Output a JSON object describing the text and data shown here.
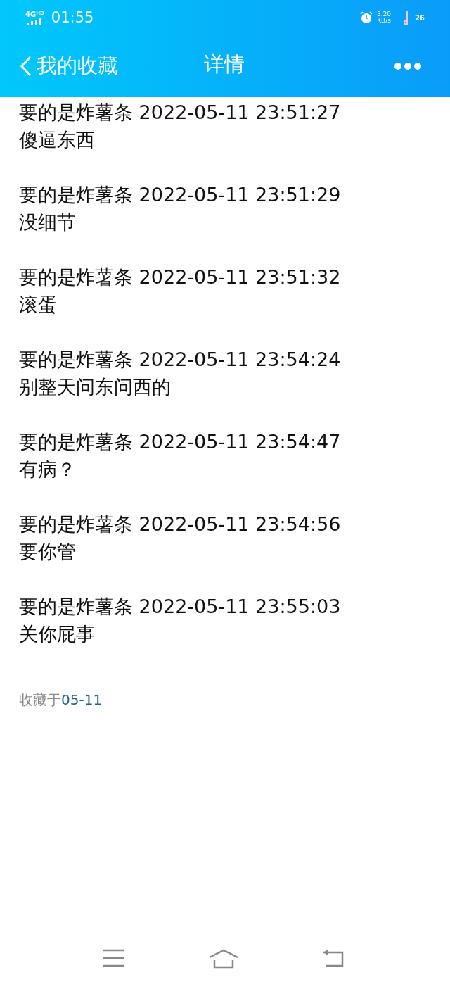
{
  "status_bar": {
    "network": "4G",
    "network_badge": "HD",
    "time": "01:55",
    "speed_value": "3.20",
    "speed_unit": "KB/s",
    "battery": "26"
  },
  "nav": {
    "back_label": "我的收藏",
    "title": "详情"
  },
  "messages": [
    {
      "sender": "要的是炸薯条",
      "time": "2022-05-11 23:51:27",
      "text": "傻逼东西"
    },
    {
      "sender": "要的是炸薯条",
      "time": "2022-05-11 23:51:29",
      "text": "没细节"
    },
    {
      "sender": "要的是炸薯条",
      "time": "2022-05-11 23:51:32",
      "text": "滚蛋"
    },
    {
      "sender": "要的是炸薯条",
      "time": "2022-05-11 23:54:24",
      "text": "别整天问东问西的"
    },
    {
      "sender": "要的是炸薯条",
      "time": "2022-05-11 23:54:47",
      "text": "有病？"
    },
    {
      "sender": "要的是炸薯条",
      "time": "2022-05-11 23:54:56",
      "text": "要你管"
    },
    {
      "sender": "要的是炸薯条",
      "time": "2022-05-11 23:55:03",
      "text": "关你屁事"
    }
  ],
  "footer": {
    "label": "收藏于",
    "date": "05-11"
  }
}
